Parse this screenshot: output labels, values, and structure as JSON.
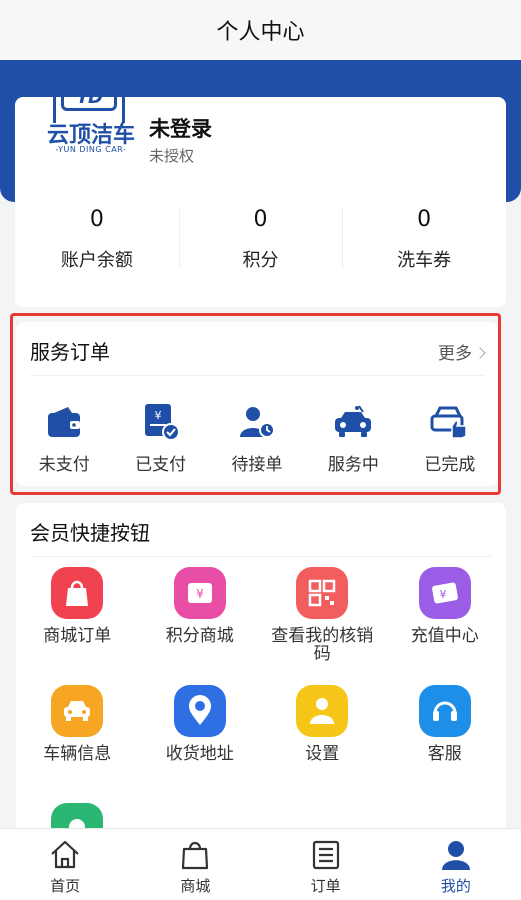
{
  "header": {
    "title": "个人中心"
  },
  "profile": {
    "logo_text_cn": "云顶洁车",
    "logo_text_en": "-YUN DING CAR-",
    "logo_mark": "YD",
    "name": "未登录",
    "status": "未授权",
    "stats": [
      {
        "value": "0",
        "label": "账户余额"
      },
      {
        "value": "0",
        "label": "积分"
      },
      {
        "value": "0",
        "label": "洗车券"
      }
    ]
  },
  "orders": {
    "title": "服务订单",
    "more": "更多",
    "items": [
      {
        "label": "未支付",
        "icon": "wallet-icon"
      },
      {
        "label": "已支付",
        "icon": "paid-receipt-icon"
      },
      {
        "label": "待接单",
        "icon": "user-clock-icon"
      },
      {
        "label": "服务中",
        "icon": "car-wash-icon"
      },
      {
        "label": "已完成",
        "icon": "car-thumbs-up-icon"
      }
    ]
  },
  "quick": {
    "title": "会员快捷按钮",
    "items": [
      {
        "label": "商城订单",
        "icon": "shopping-bag-icon",
        "color": "#f0434f"
      },
      {
        "label": "积分商城",
        "icon": "points-mall-icon",
        "color": "#e94ea6"
      },
      {
        "label": "查看我的核销码",
        "icon": "qr-code-icon",
        "color": "#f25d5d"
      },
      {
        "label": "充值中心",
        "icon": "recharge-card-icon",
        "color": "#9b5de5"
      },
      {
        "label": "车辆信息",
        "icon": "car-icon",
        "color": "#f6a623"
      },
      {
        "label": "收货地址",
        "icon": "location-pin-icon",
        "color": "#2f6fe4"
      },
      {
        "label": "设置",
        "icon": "settings-person-icon",
        "color": "#f5c518"
      },
      {
        "label": "客服",
        "icon": "headset-icon",
        "color": "#1e8fe8"
      },
      {
        "label": "",
        "icon": "bell-icon",
        "color": "#2bb673"
      }
    ]
  },
  "tabs": [
    {
      "label": "首页",
      "icon": "home-icon"
    },
    {
      "label": "商城",
      "icon": "shopping-bag-icon"
    },
    {
      "label": "订单",
      "icon": "order-list-icon"
    },
    {
      "label": "我的",
      "icon": "user-icon",
      "active": true
    }
  ],
  "colors": {
    "brand": "#1f4fa6",
    "highlight": "#e53935"
  }
}
